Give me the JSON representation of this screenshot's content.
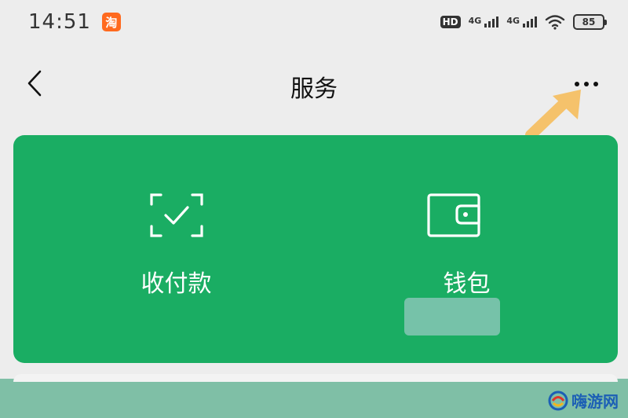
{
  "status_bar": {
    "time": "14:51",
    "app_icon_char": "淘",
    "hd_label": "HD",
    "network_1": "4G",
    "network_2": "4G",
    "battery_level": "85",
    "icons": [
      "taobao-icon",
      "hd-icon",
      "signal-icon",
      "wifi-icon",
      "battery-icon"
    ]
  },
  "nav": {
    "title": "服务",
    "back_icon": "chevron-left-icon",
    "more_icon": "more-dots-icon"
  },
  "service_card": {
    "color": "#1aad63",
    "tiles": [
      {
        "label": "收付款",
        "icon": "scan-check-icon"
      },
      {
        "label": "钱包",
        "icon": "wallet-icon"
      }
    ]
  },
  "watermark": {
    "text": "嗨游网",
    "icon": "logo-icon"
  },
  "colors": {
    "background": "#ededed",
    "hint_arrow": "#f5c26b"
  }
}
